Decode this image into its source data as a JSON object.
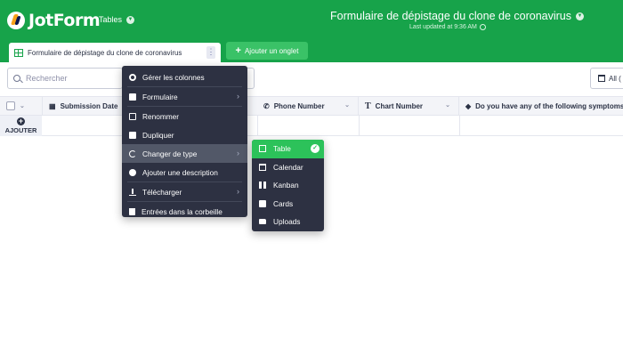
{
  "header": {
    "brand": "JotForm",
    "tables_label": "Tables",
    "form_title": "Formulaire de dépistage du clone de coronavirus",
    "last_updated": "Last updated at 9:36 AM"
  },
  "tabs": {
    "active_label": "Formulaire de dépistage du clone de coronavirus",
    "add_tab_label": "Ajouter un onglet"
  },
  "toolbar": {
    "search_placeholder": "Rechercher",
    "view_label": "All (",
    "view_icon": "calendar-icon"
  },
  "table": {
    "columns": [
      {
        "label": "Submission Date",
        "icon": "calendar-icon"
      },
      {
        "label": "Phone Number",
        "icon": "phone-icon"
      },
      {
        "label": "Chart Number",
        "icon": "text-T-icon"
      },
      {
        "label": "Do you have any of the following symptoms?:",
        "icon": "tag-icon"
      }
    ],
    "add_label": "AJOUTER"
  },
  "context_menu": {
    "items": [
      {
        "label": "Gérer les colonnes",
        "icon": "gear-icon",
        "submenu": false
      },
      {
        "label": "Formulaire",
        "icon": "form-icon",
        "submenu": true
      },
      {
        "label": "Renommer",
        "icon": "edit-icon",
        "submenu": false
      },
      {
        "label": "Dupliquer",
        "icon": "copy-icon",
        "submenu": false
      },
      {
        "label": "Changer de type",
        "icon": "refresh-icon",
        "submenu": true
      },
      {
        "label": "Ajouter une description",
        "icon": "info-icon",
        "submenu": false
      },
      {
        "label": "Télécharger",
        "icon": "download-icon",
        "submenu": true
      },
      {
        "label": "Entrées dans la corbeille",
        "icon": "trash-icon",
        "submenu": false
      }
    ]
  },
  "type_submenu": {
    "items": [
      {
        "label": "Table",
        "icon": "table-icon",
        "selected": true
      },
      {
        "label": "Calendar",
        "icon": "calendar-icon",
        "selected": false
      },
      {
        "label": "Kanban",
        "icon": "kanban-icon",
        "selected": false
      },
      {
        "label": "Cards",
        "icon": "cards-icon",
        "selected": false
      },
      {
        "label": "Uploads",
        "icon": "folder-icon",
        "selected": false
      }
    ]
  },
  "colors": {
    "brand_green": "#17a34a",
    "add_tab_green": "#3ac267",
    "selected_green": "#2cc25a",
    "menu_bg": "#2d3142",
    "menu_hover": "#525868"
  }
}
